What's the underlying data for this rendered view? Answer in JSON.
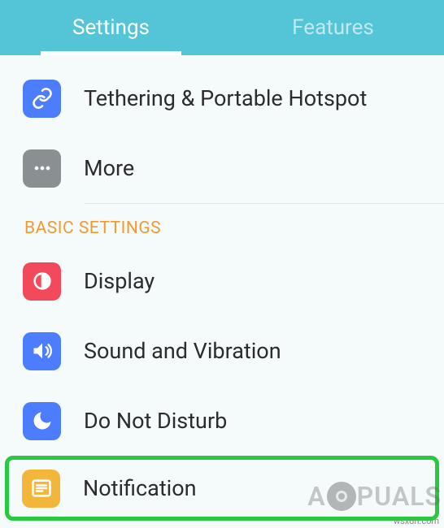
{
  "tabs": {
    "settings": "Settings",
    "features": "Features"
  },
  "items": {
    "tethering": "Tethering & Portable Hotspot",
    "more": "More",
    "display": "Display",
    "sound": "Sound and Vibration",
    "dnd": "Do Not Disturb",
    "notification": "Notification"
  },
  "section": {
    "basic": "BASIC SETTINGS"
  },
  "watermark": {
    "prefix": "A",
    "suffix": "PUALS"
  },
  "source": "wsxdn.com"
}
